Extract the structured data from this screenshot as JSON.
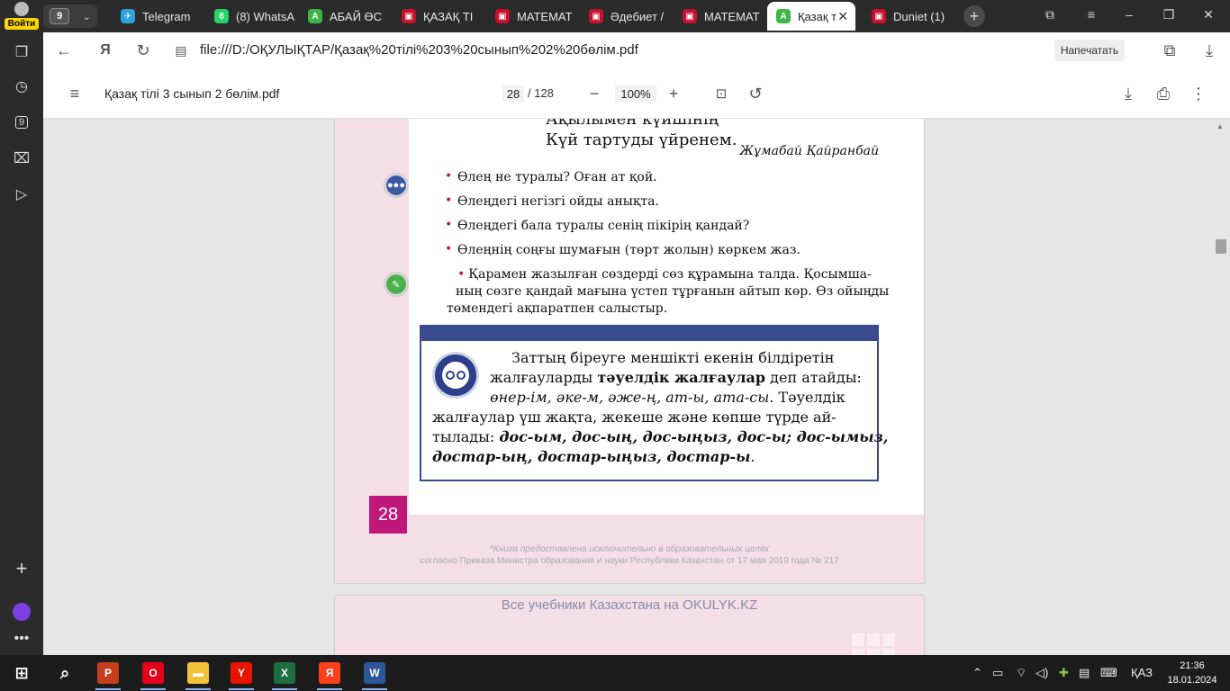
{
  "browser": {
    "login_label": "Войти",
    "tab_group_count": "9",
    "tabs": [
      {
        "title": "Telegram",
        "icon": "telegram-icon",
        "color": "#2aa3df",
        "glyph": "✈"
      },
      {
        "title": "(8) WhatsA",
        "icon": "whatsapp-icon",
        "color": "#25d366",
        "glyph": "8"
      },
      {
        "title": "АБАЙ ӨС",
        "icon": "okulyk-icon",
        "color": "#3fb548",
        "glyph": "A"
      },
      {
        "title": "ҚАЗАҚ ТІ",
        "icon": "pdf-icon",
        "color": "#c8102e",
        "glyph": "▣"
      },
      {
        "title": "МАТЕМАТ",
        "icon": "pdf-icon",
        "color": "#c8102e",
        "glyph": "▣"
      },
      {
        "title": "Әдебиет /",
        "icon": "pdf-icon",
        "color": "#c8102e",
        "glyph": "▣"
      },
      {
        "title": "МАТЕМАТ",
        "icon": "pdf-icon",
        "color": "#c8102e",
        "glyph": "▣"
      },
      {
        "title": "Қазақ т",
        "icon": "okulyk-icon",
        "color": "#3fb548",
        "glyph": "A",
        "active": true
      },
      {
        "title": "Duniet (1)",
        "icon": "pdf-icon",
        "color": "#c8102e",
        "glyph": "▣"
      }
    ],
    "url": "file:///D:/ОҚУЛЫҚТАР/Қазақ%20тілі%203%20сынып%202%20бөлім.pdf",
    "print_label": "Напечатать",
    "sidebar_badge": "9"
  },
  "pdf": {
    "file_name": "Қазақ тілі 3 сынып 2 бөлім.pdf",
    "current_page": "28",
    "total_pages": "/ 128",
    "zoom": "100%"
  },
  "page": {
    "poem_lines": [
      "Ақылымен күйшінің",
      "Күй тартуды үйренем."
    ],
    "author": "Жұмабай Қайранбай",
    "tasks": [
      "Өлең не туралы? Оған ат қой.",
      "Өлеңдегі негізгі ойды анықта.",
      "Өлеңдегі бала туралы сенің пікірің қандай?",
      "Өлеңнің соңғы шумағын (төрт жолын) көркем жаз."
    ],
    "exercise_lines": [
      "Қарамен жазылған сөздерді сөз құрамына талда. Қосымша-",
      "ның сөзге қандай мағына үстеп тұрғанын айтып көр. Өз ойыңды",
      "төмендегі ақпаратпен салыстыр."
    ],
    "rule_lines": [
      {
        "pre": "Заттың біреуге меншікті екенін білдіретін",
        "bold": "",
        "post": ""
      },
      {
        "pre": "жалғауларды ",
        "bold": "тәуелдік жалғаулар",
        "post": " деп атайды:"
      },
      {
        "pre": "өнер-ім, әке-м, әже-ң, ат-ы, ата-сы",
        "bold": "",
        "post": ". Тәуелдік"
      },
      {
        "pre": "жалғаулар үш жақта, жекеше және көпше түрде ай-",
        "bold": "",
        "post": ""
      },
      {
        "pre": "тылады: ",
        "bold": "дос-ым, дос-ың, дос-ыңыз, дос-ы; дос-ымыз,",
        "post": ""
      },
      {
        "pre": "",
        "bold": "достар-ың, достар-ыңыз, достар-ы",
        "post": "."
      }
    ],
    "page_number": "28",
    "disclaimer_1": "*Книга предоставлена исключительно в образовательных целях",
    "disclaimer_2": "согласно Приказа Министра образования и науки Республики Казахстан от 17 мая 2019 года № 217",
    "next_page_banner": "Все учебники Казахстана на OKULYK.KZ"
  },
  "taskbar": {
    "apps": [
      {
        "name": "powerpoint",
        "color": "#c43e1c",
        "glyph": "P"
      },
      {
        "name": "opera",
        "color": "#e2001a",
        "glyph": "O"
      },
      {
        "name": "file-explorer",
        "color": "#f3c13a",
        "glyph": "▬"
      },
      {
        "name": "yandex-browser",
        "color": "#e61400",
        "glyph": "Y"
      },
      {
        "name": "excel",
        "color": "#1d6f42",
        "glyph": "X"
      },
      {
        "name": "yandex",
        "color": "#fc3f1d",
        "glyph": "Я"
      },
      {
        "name": "word",
        "color": "#2b579a",
        "glyph": "W"
      }
    ],
    "language": "ҚАЗ",
    "time": "21:36",
    "date": "18.01.2024"
  }
}
